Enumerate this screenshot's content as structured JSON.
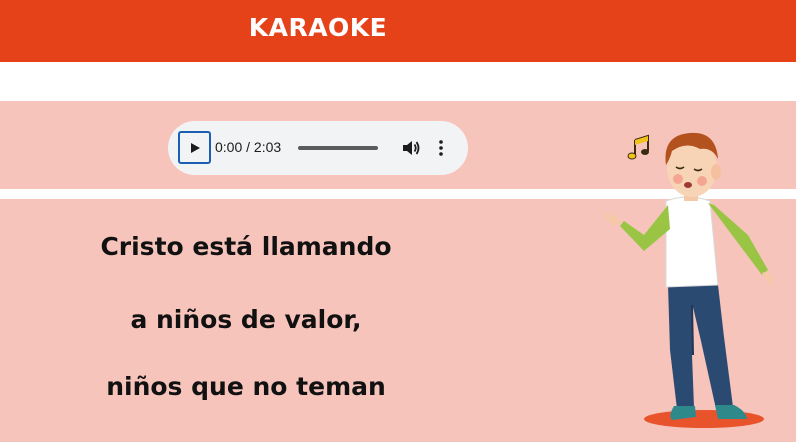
{
  "header": {
    "title": "KARAOKE"
  },
  "player": {
    "time": "0:00 / 2:03",
    "progress": 0,
    "icons": {
      "play": "play-icon",
      "volume": "volume-icon",
      "more": "more-vert-icon"
    }
  },
  "lyrics": [
    "Cristo está llamando",
    "a niños de valor,",
    "niños que no teman"
  ],
  "colors": {
    "header": "#e64219",
    "background": "#f6c4bb",
    "stripe": "#ffffff",
    "text": "#111111"
  },
  "illustration": {
    "subject": "singing-boy-illustration",
    "note": "music-note-icon"
  }
}
